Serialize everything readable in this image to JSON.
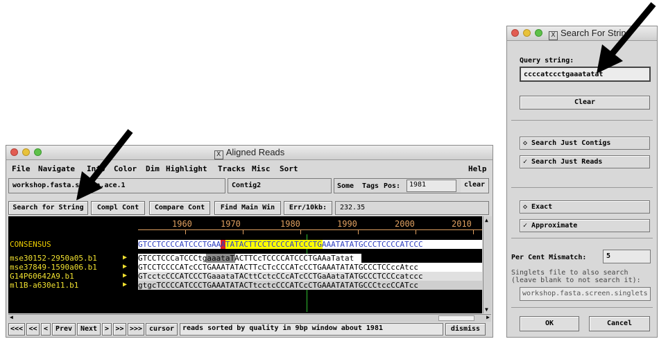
{
  "aligned_window": {
    "title": "Aligned Reads",
    "menu": [
      "File",
      "Navigate",
      "Info",
      "Color",
      "Dim",
      "Highlight",
      "Tracks",
      "Misc",
      "Sort"
    ],
    "help": "Help",
    "filename": "workshop.fasta.screen.ace.1",
    "contig": "Contig2",
    "some_label": "Some",
    "tags_label": "Tags",
    "pos_label": "Pos:",
    "pos_value": "1981",
    "clear_label": "clear",
    "buttons": [
      "Search for String",
      "Compl Cont",
      "Compare Cont",
      "Find Main Win",
      "Err/10kb:"
    ],
    "err_value": "232.35",
    "ruler": [
      "1960",
      "1970",
      "1980",
      "1990",
      "2000",
      "2010"
    ],
    "rows": [
      {
        "name": "CONSENSUS",
        "seq": "GTCCTCCCCATCCCTGAAATATACTTCCTCCCCATCCCTGAAATATATGCCCTCCCCATCCC"
      },
      {
        "name": "mse30152-2950a05.b1",
        "seq": "GTCCTCCCaTCCCtgaaataTACTTCcTCCCCATCCCTGAAaTatat"
      },
      {
        "name": "mse37849-1590a06.b1",
        "seq": "GTCCTCCCCATcCCTGAAATATACTTcCTcCCCATcCCTGAAATATATGCCCTCCccAtcc"
      },
      {
        "name": "G14P60642A9.b1",
        "seq": "GTcctcCCCATCCCTGaaataTACttCctcCCcATcCCTGaAataTATGCCCTCCCcatccc"
      },
      {
        "name": "ml1B-a630e11.b1",
        "seq": "gtgcTCCCCATCCCTGAAATATACTtcctcCCCATCcCTGAAATATATGCCCtccCCATcc"
      }
    ],
    "nav_buttons": [
      "<<<",
      "<<",
      "<",
      "Prev",
      "Next",
      ">",
      ">>",
      ">>>",
      "cursor"
    ],
    "status": "reads sorted by quality in 9bp window about 1981",
    "dismiss": "dismiss",
    "colors": {
      "ruler": "#e0a060",
      "names": "#f0e030",
      "highlight": "#ffff00",
      "cursor": "#e02020"
    }
  },
  "search_window": {
    "title": "Search For String",
    "query_label": "Query string:",
    "query_value": "ccccatccctgaaatatat",
    "clear_button": "Clear",
    "options": [
      "Search Just Contigs",
      "Search Just Reads",
      "Exact",
      "Approximate"
    ],
    "mismatch_label": "Per Cent Mismatch:",
    "mismatch_value": "5",
    "singlets_label_1": "Singlets file to also search",
    "singlets_label_2": "(leave blank to not search it):",
    "singlets_value": "workshop.fasta.screen.singlets",
    "ok_button": "OK",
    "cancel_button": "Cancel"
  }
}
